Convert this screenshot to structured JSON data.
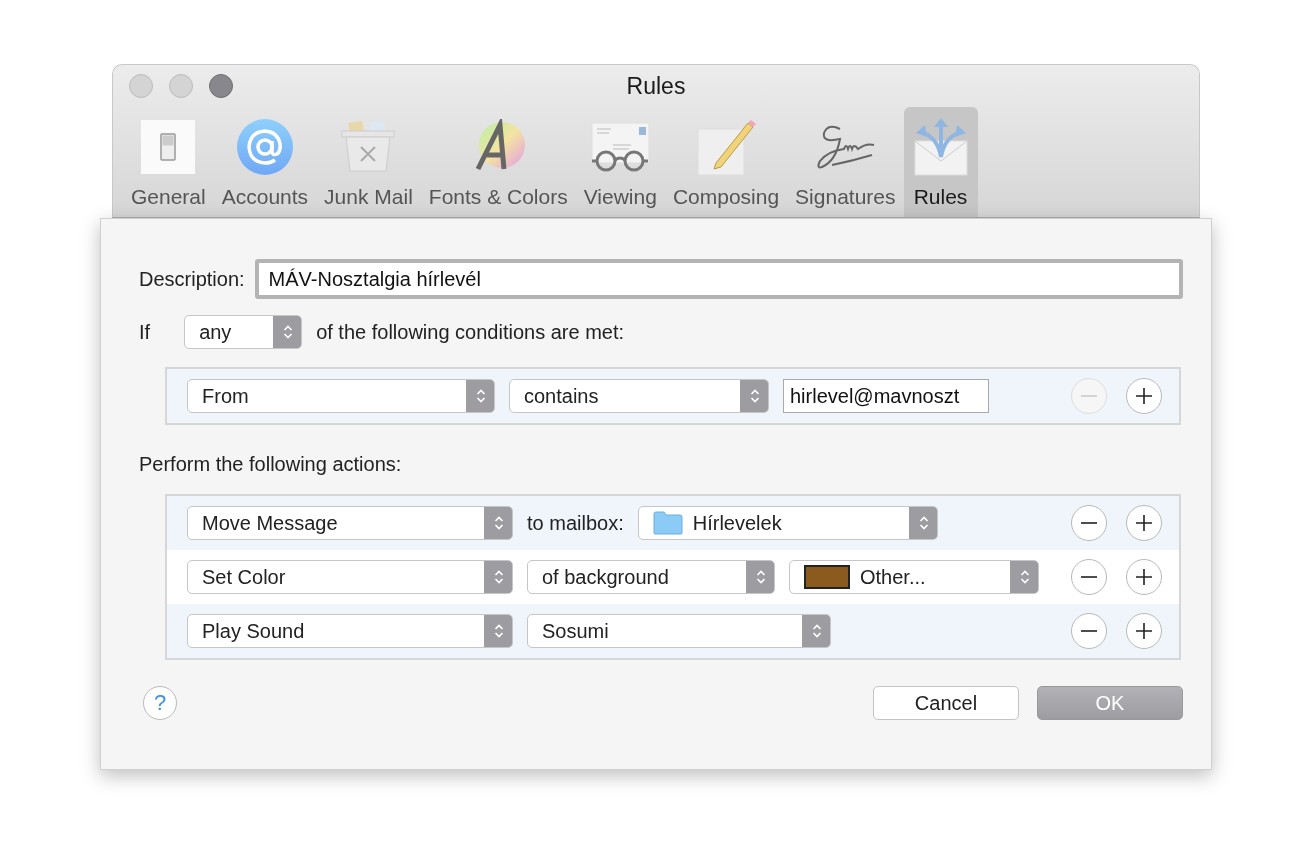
{
  "window": {
    "title": "Rules"
  },
  "toolbar": [
    {
      "label": "General",
      "kind": "general",
      "selected": false
    },
    {
      "label": "Accounts",
      "kind": "accounts",
      "selected": false
    },
    {
      "label": "Junk Mail",
      "kind": "junk",
      "selected": false
    },
    {
      "label": "Fonts & Colors",
      "kind": "fonts",
      "selected": false
    },
    {
      "label": "Viewing",
      "kind": "viewing",
      "selected": false
    },
    {
      "label": "Composing",
      "kind": "composing",
      "selected": false
    },
    {
      "label": "Signatures",
      "kind": "signatures",
      "selected": false
    },
    {
      "label": "Rules",
      "kind": "rules",
      "selected": true
    }
  ],
  "description": {
    "label": "Description:",
    "value": "MÁV-Nosztalgia hírlevél"
  },
  "condition_header": {
    "prefix": "If",
    "match": "any",
    "suffix": "of the following conditions are met:"
  },
  "conditions": [
    {
      "field": "From",
      "operator": "contains",
      "value": "hirlevel@mavnoszt",
      "remove_disabled": true
    }
  ],
  "actions_header": "Perform the following actions:",
  "actions": [
    {
      "kind": "move",
      "action": "Move Message",
      "label": "to mailbox:",
      "mailbox": "Hírlevelek",
      "remove_disabled": false
    },
    {
      "kind": "color",
      "action": "Set Color",
      "target": "of background",
      "color": "#8b5a1e",
      "color_label": "Other...",
      "remove_disabled": false
    },
    {
      "kind": "sound",
      "action": "Play Sound",
      "sound": "Sosumi",
      "remove_disabled": false
    }
  ],
  "help": "?",
  "buttons": [
    {
      "label": "Cancel",
      "kind": "cancel"
    },
    {
      "label": "OK",
      "kind": "default"
    }
  ]
}
